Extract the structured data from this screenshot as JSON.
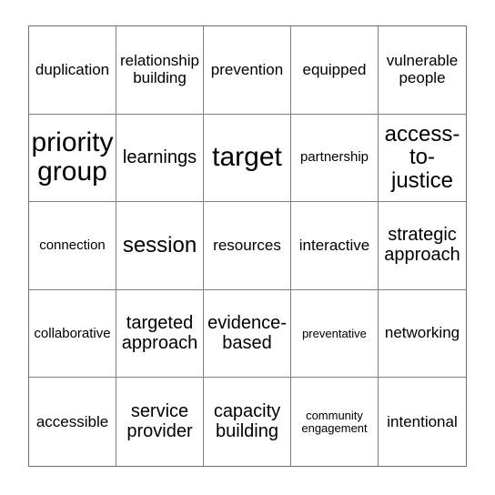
{
  "card": {
    "type": "bingo-card",
    "grid": {
      "columns": 5,
      "rows": 5
    },
    "colors": {
      "background": "#ffffff",
      "text": "#000000",
      "grid_line": "#808080",
      "outer_border": "#6e6e6e"
    },
    "cells": [
      {
        "text": "duplication",
        "size": "md"
      },
      {
        "text": "relationship building",
        "size": "md"
      },
      {
        "text": "prevention",
        "size": "md"
      },
      {
        "text": "equipped",
        "size": "md"
      },
      {
        "text": "vulnerable people",
        "size": "md"
      },
      {
        "text": "priority group",
        "size": "xxl"
      },
      {
        "text": "learnings",
        "size": "lg"
      },
      {
        "text": "target",
        "size": "xxl"
      },
      {
        "text": "partnership",
        "size": "sm"
      },
      {
        "text": "access-to-justice",
        "size": "xl"
      },
      {
        "text": "connection",
        "size": "sm"
      },
      {
        "text": "session",
        "size": "xl"
      },
      {
        "text": "resources",
        "size": "md"
      },
      {
        "text": "interactive",
        "size": "md"
      },
      {
        "text": "strategic approach",
        "size": "lg"
      },
      {
        "text": "collaborative",
        "size": "sm"
      },
      {
        "text": "targeted approach",
        "size": "lg"
      },
      {
        "text": "evidence-based",
        "size": "lg"
      },
      {
        "text": "preventative",
        "size": "xs"
      },
      {
        "text": "networking",
        "size": "md"
      },
      {
        "text": "accessible",
        "size": "md"
      },
      {
        "text": "service provider",
        "size": "lg"
      },
      {
        "text": "capacity building",
        "size": "lg"
      },
      {
        "text": "community engagement",
        "size": "xs"
      },
      {
        "text": "intentional",
        "size": "md"
      }
    ]
  }
}
